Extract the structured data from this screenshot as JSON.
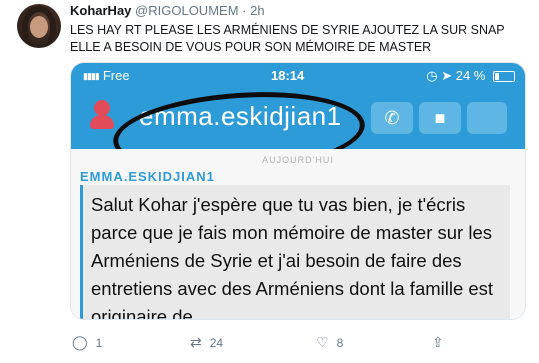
{
  "tweet": {
    "display_name": "KoharHay",
    "handle": "@RIGOLOUMEM",
    "separator": "·",
    "time": "2h",
    "text": "LES HAY RT PLEASE LES ARMÉNIENS DE SYRIE AJOUTEZ LA SUR SNAP ELLE A BESOIN DE VOUS POUR SON MÉMOIRE DE MASTER"
  },
  "screenshot": {
    "status_bar": {
      "carrier": "Free",
      "time": "18:14",
      "battery": "24 %"
    },
    "chat_header": {
      "username": "emma.eskidjian1"
    },
    "chat": {
      "day_label": "AUJOURD'HUI",
      "sender": "EMMA.ESKIDJIAN1",
      "message": "Salut Kohar j'espère que tu vas bien, je t'écris parce que je fais mon mémoire de master sur les Arméniens de Syrie et j'ai besoin de faire des entretiens avec des Arméniens dont la famille est originaire de"
    }
  },
  "actions": {
    "reply_count": "1",
    "retweet_count": "24",
    "like_count": "8"
  },
  "icons": {
    "reply": "reply-icon",
    "retweet": "retweet-icon",
    "like": "heart-icon",
    "share": "share-icon"
  },
  "colors": {
    "snap_blue": "#2d9bd8",
    "sender_blue": "#2d9bd8",
    "bitmoji_red": "#e24b5a"
  }
}
